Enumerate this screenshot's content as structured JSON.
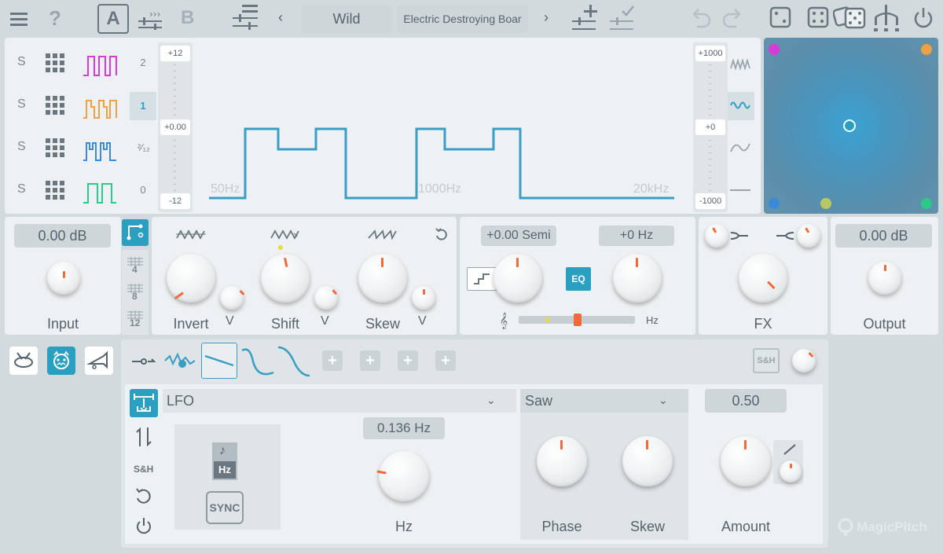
{
  "header": {
    "preset_a_label": "A",
    "preset_b_label": "B",
    "help_label": "?",
    "preset_category": "Wild",
    "preset_name": "Electric Destroying Boar"
  },
  "wave_rows": [
    {
      "solo": "S",
      "color": "#d83ad8"
    },
    {
      "solo": "S",
      "color": "#f0a040"
    },
    {
      "solo": "S",
      "color": "#3a8ad8"
    },
    {
      "solo": "S",
      "color": "#2ec888"
    }
  ],
  "octave_labels": [
    "2",
    "1",
    "²⁄₁₂",
    "0"
  ],
  "pitch_slider": {
    "top": "+12",
    "mid": "+0.00",
    "bottom": "-12"
  },
  "freq_labels": [
    "50Hz",
    "1000Hz",
    "20kHz"
  ],
  "hz_slider": {
    "top": "+1000",
    "mid": "+0",
    "bottom": "-1000"
  },
  "xy_pad_colors": [
    "#d83ad8",
    "#f0a040",
    "#3a8ad8",
    "#b8c864",
    "#2ec888"
  ],
  "input": {
    "value": "0.00 dB",
    "label": "Input"
  },
  "output": {
    "value": "0.00 dB",
    "label": "Output"
  },
  "grid_divs": [
    "4",
    "8",
    "12"
  ],
  "shape": {
    "invert_label": "Invert",
    "shift_label": "Shift",
    "skew_label": "Skew",
    "chevron": "V"
  },
  "tune": {
    "semi_value": "+0.00 Semi",
    "hz_value": "+0 Hz",
    "eq_label": "EQ",
    "hz_unit": "Hz"
  },
  "fx": {
    "label": "FX"
  },
  "mod": {
    "source_type": "LFO",
    "sh_label": "S&H",
    "rate_value": "0.136 Hz",
    "rate_label": "Hz",
    "hz_toggle": "Hz",
    "sync_label": "SYNC",
    "wave_type": "Saw",
    "phase_label": "Phase",
    "skew_label": "Skew",
    "amount_value": "0.50",
    "amount_label": "Amount"
  },
  "brand": "MagicPitch",
  "colors": {
    "accent": "#2a9fbf",
    "wave": "#3a9dc4",
    "indicator": "#f26a3a",
    "xy_bg": "#4f8db0"
  }
}
